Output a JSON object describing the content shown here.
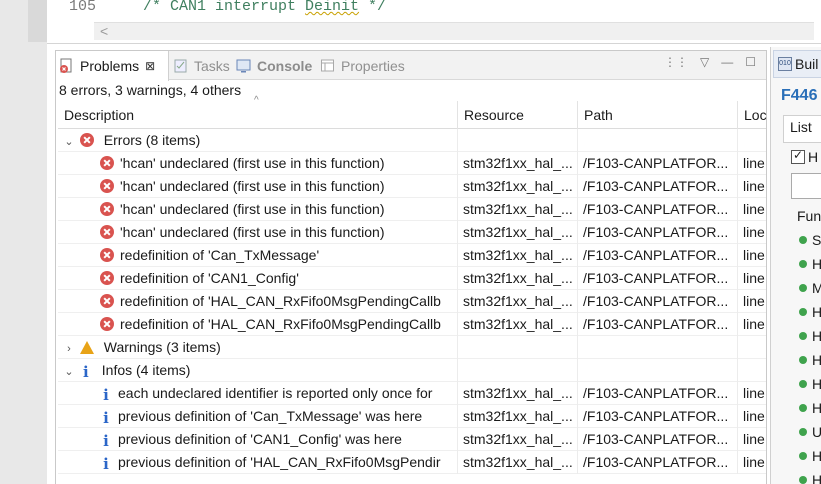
{
  "editor": {
    "line_number": "105",
    "code_prefix": "/* CAN1 interrupt ",
    "code_squiggle": "Deinit",
    "code_suffix": " */",
    "scroll_arrow": "<"
  },
  "tabs": [
    {
      "label": "Problems",
      "close": "⊠"
    },
    {
      "label": "Tasks"
    },
    {
      "label": "Console"
    },
    {
      "label": "Properties"
    }
  ],
  "panel_actions": [
    "⋮⋮",
    "▽",
    "—",
    "☐"
  ],
  "summary": "8 errors, 3 warnings, 4 others",
  "columns": [
    "Description",
    "Resource",
    "Path",
    "Loc"
  ],
  "sort_caret": "^",
  "groups": {
    "errors": {
      "label": "Errors (8 items)",
      "expanded": true,
      "rows": [
        {
          "desc": "'hcan' undeclared (first use in this function)",
          "resource": "stm32f1xx_hal_...",
          "path": "/F103-CANPLATFOR...",
          "loc": "line"
        },
        {
          "desc": "'hcan' undeclared (first use in this function)",
          "resource": "stm32f1xx_hal_...",
          "path": "/F103-CANPLATFOR...",
          "loc": "line"
        },
        {
          "desc": "'hcan' undeclared (first use in this function)",
          "resource": "stm32f1xx_hal_...",
          "path": "/F103-CANPLATFOR...",
          "loc": "line"
        },
        {
          "desc": "'hcan' undeclared (first use in this function)",
          "resource": "stm32f1xx_hal_...",
          "path": "/F103-CANPLATFOR...",
          "loc": "line"
        },
        {
          "desc": "redefinition of 'Can_TxMessage'",
          "resource": "stm32f1xx_hal_...",
          "path": "/F103-CANPLATFOR...",
          "loc": "line"
        },
        {
          "desc": "redefinition of 'CAN1_Config'",
          "resource": "stm32f1xx_hal_...",
          "path": "/F103-CANPLATFOR...",
          "loc": "line"
        },
        {
          "desc": "redefinition of 'HAL_CAN_RxFifo0MsgPendingCallb",
          "resource": "stm32f1xx_hal_...",
          "path": "/F103-CANPLATFOR...",
          "loc": "line"
        },
        {
          "desc": "redefinition of 'HAL_CAN_RxFifo0MsgPendingCallb",
          "resource": "stm32f1xx_hal_...",
          "path": "/F103-CANPLATFOR...",
          "loc": "line"
        }
      ]
    },
    "warnings": {
      "label": "Warnings (3 items)",
      "expanded": false
    },
    "infos": {
      "label": "Infos (4 items)",
      "expanded": true,
      "rows": [
        {
          "desc": "each undeclared identifier is reported only once for",
          "resource": "stm32f1xx_hal_...",
          "path": "/F103-CANPLATFOR...",
          "loc": "line"
        },
        {
          "desc": "previous definition of 'Can_TxMessage' was here",
          "resource": "stm32f1xx_hal_...",
          "path": "/F103-CANPLATFOR...",
          "loc": "line"
        },
        {
          "desc": "previous definition of 'CAN1_Config' was here",
          "resource": "stm32f1xx_hal_...",
          "path": "/F103-CANPLATFOR...",
          "loc": "line"
        },
        {
          "desc": "previous definition of 'HAL_CAN_RxFifo0MsgPendir",
          "resource": "stm32f1xx_hal_...",
          "path": "/F103-CANPLATFOR...",
          "loc": "line"
        }
      ]
    }
  },
  "right_panel": {
    "tab_label": "Buil",
    "tab_icon_text": "010",
    "title": "F446",
    "list_label": "List",
    "check_label": "H",
    "functions_label": "Func",
    "items": [
      "S",
      "H",
      "M",
      "H",
      "H",
      "H",
      "H",
      "H",
      "U",
      "H",
      "H"
    ]
  },
  "colors": {
    "error": "#d9534f",
    "warning": "#e8a317",
    "info": "#2b66c8",
    "link_title": "#2a6fb8",
    "comment": "#3f7f5f"
  }
}
